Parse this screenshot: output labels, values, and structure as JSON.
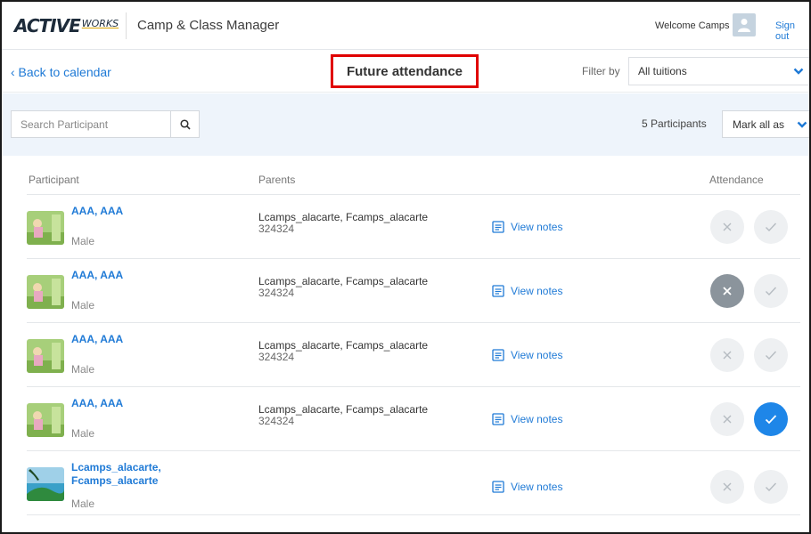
{
  "header": {
    "logo_main": "ACTIVE",
    "logo_sub": "WORKS",
    "app_title": "Camp & Class Manager",
    "welcome": "Welcome Camps",
    "sign_out": "Sign out"
  },
  "nav": {
    "back": "‹ Back to calendar",
    "page_title": "Future attendance",
    "filter_label": "Filter by",
    "filter_value": "All tuitions"
  },
  "toolbar": {
    "search_placeholder": "Search Participant",
    "participant_count": "5 Participants",
    "mark_all": "Mark all as"
  },
  "table": {
    "headers": {
      "participant": "Participant",
      "parents": "Parents",
      "attendance": "Attendance"
    },
    "rows": [
      {
        "name": "AAA, AAA",
        "gender": "Male",
        "parents": "Lcamps_alacarte, Fcamps_alacarte",
        "phone": "324324",
        "notes": "View notes",
        "attendance": "none"
      },
      {
        "name": "AAA, AAA",
        "gender": "Male",
        "parents": "Lcamps_alacarte, Fcamps_alacarte",
        "phone": "324324",
        "notes": "View notes",
        "attendance": "absent"
      },
      {
        "name": "AAA, AAA",
        "gender": "Male",
        "parents": "Lcamps_alacarte, Fcamps_alacarte",
        "phone": "324324",
        "notes": "View notes",
        "attendance": "none"
      },
      {
        "name": "AAA, AAA",
        "gender": "Male",
        "parents": "Lcamps_alacarte, Fcamps_alacarte",
        "phone": "324324",
        "notes": "View notes",
        "attendance": "present"
      },
      {
        "name_line1": "Lcamps_alacarte,",
        "name_line2": "Fcamps_alacarte",
        "gender": "Male",
        "parents": "",
        "phone": "",
        "notes": "View notes",
        "attendance": "none"
      }
    ]
  },
  "colors": {
    "link": "#1f7ad6",
    "highlight_border": "#e00000",
    "band": "#eef4fb",
    "present_active": "#1e86e8",
    "absent_active": "#8b949c"
  },
  "icons": {
    "search": "search-icon",
    "chevron": "chevron-down-icon",
    "notes": "document-icon",
    "absent": "close-icon",
    "present": "check-icon",
    "user": "user-icon"
  }
}
